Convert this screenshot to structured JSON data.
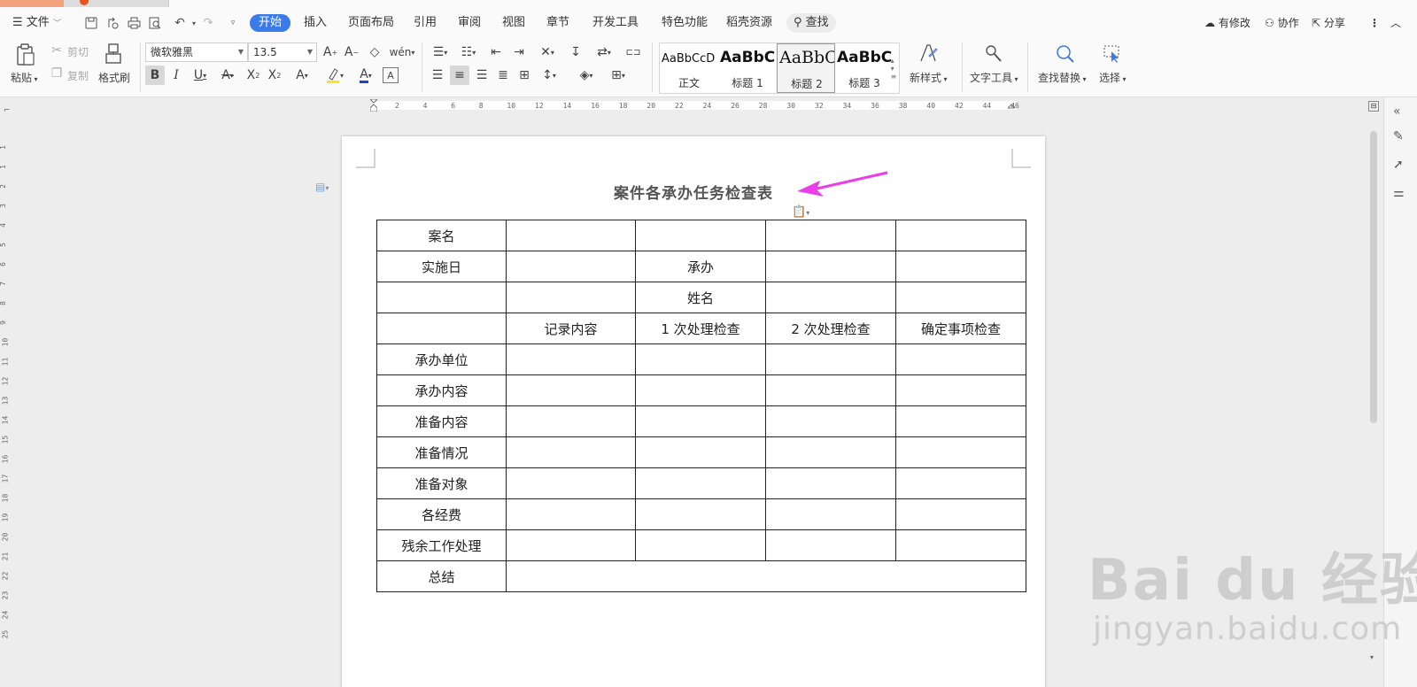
{
  "menu": {
    "file": "文件",
    "tabs": [
      "开始",
      "插入",
      "页面布局",
      "引用",
      "审阅",
      "视图",
      "章节",
      "开发工具",
      "特色功能",
      "稻壳资源"
    ],
    "search": "查找",
    "right": {
      "modified": "有修改",
      "collab": "协作",
      "share": "分享"
    }
  },
  "ribbon": {
    "paste": "粘贴",
    "cut": "剪切",
    "copy": "复制",
    "format_painter": "格式刷",
    "font_name": "微软雅黑",
    "font_size": "13.5",
    "styles": [
      {
        "preview": "AaBbCcD",
        "name": "正文"
      },
      {
        "preview": "AaBbC",
        "name": "标题 1"
      },
      {
        "preview": "AaBbC",
        "name": "标题 2"
      },
      {
        "preview": "AaBbC",
        "name": "标题 3"
      }
    ],
    "new_style": "新样式",
    "text_tools": "文字工具",
    "find_replace": "查找替换",
    "select": "选择"
  },
  "ruler": {
    "h_ticks": [
      "2",
      "4",
      "6",
      "8",
      "10",
      "12",
      "14",
      "16",
      "18",
      "20",
      "22",
      "24",
      "26",
      "28",
      "30",
      "32",
      "34",
      "36",
      "38",
      "40",
      "42",
      "44",
      "46"
    ],
    "v_ticks": [
      "1",
      "1",
      "2",
      "3",
      "4",
      "5",
      "6",
      "7",
      "8",
      "9",
      "10",
      "11",
      "12",
      "13",
      "14",
      "15",
      "16",
      "17",
      "18",
      "19",
      "20",
      "21",
      "22",
      "23",
      "24",
      "25"
    ]
  },
  "document": {
    "title": "案件各承办任务检查表",
    "rows": [
      [
        "案名",
        "",
        "",
        "",
        ""
      ],
      [
        "实施日",
        "",
        "承办",
        "",
        ""
      ],
      [
        "",
        "",
        "姓名",
        "",
        ""
      ],
      [
        "",
        "记录内容",
        "1 次处理检查",
        "2 次处理检查",
        "确定事项检查"
      ],
      [
        "承办单位",
        "",
        "",
        "",
        ""
      ],
      [
        "承办内容",
        "",
        "",
        "",
        ""
      ],
      [
        "准备内容",
        "",
        "",
        "",
        ""
      ],
      [
        "准备情况",
        "",
        "",
        "",
        ""
      ],
      [
        "准备对象",
        "",
        "",
        "",
        ""
      ],
      [
        "各经费",
        "",
        "",
        "",
        ""
      ],
      [
        "残余工作处理",
        "",
        "",
        "",
        ""
      ]
    ],
    "summary_label": "总结",
    "summary_value": ""
  },
  "watermark": {
    "main": "Bai du 经验",
    "sub": "jingyan.baidu.com"
  },
  "colors": {
    "accent": "#3b7be9",
    "arrow": "#e93ee9"
  }
}
